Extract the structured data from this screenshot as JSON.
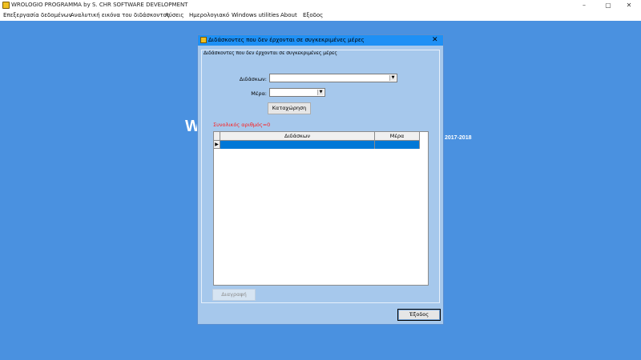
{
  "app": {
    "title": "WROLOGIO PROGRAMMA by S. CHR SOFTWARE DEVELOPMENT",
    "icon": "app-logo-icon",
    "window_controls": {
      "minimize": "–",
      "maximize": "▢",
      "close": "✕"
    }
  },
  "menu": {
    "items": [
      "Επεξεργασία δεδομένων",
      "Αναλυτική εικόνα του διδάσκοντος",
      "Λύσεις",
      "Ημερολογιακό",
      "Windows utilities",
      "About",
      "Εξοδος"
    ]
  },
  "background": {
    "big_text": "W",
    "year_text": "2017-2018",
    "color": "#4a91e0"
  },
  "dialog": {
    "title": "Διδάσκοντες που δεν έρχονται σε συγκεκριμένες μέρες",
    "close_glyph": "✕",
    "group_title": "Διδάσκοντες που δεν έρχονται σε συγκεκριμένες μέρες",
    "teacher_label": "Διδάσκων:",
    "teacher_value": "",
    "day_label": "Μέρα:",
    "day_value": "",
    "dropdown_glyph": "▼",
    "submit_label": "Καταχώρηση",
    "count_text": "Συνολικός αριθμός=0",
    "count_color": "#ff1a1a",
    "table": {
      "columns": [
        "Διδάσκων",
        "Μέρα"
      ],
      "rows": [
        [
          "",
          ""
        ]
      ],
      "row_indicator": "▶",
      "selection_color": "#0078d7"
    },
    "delete_label": "Διαγραφή",
    "exit_label": "Έξοδος",
    "title_bar_color": "#1e90f5",
    "body_color": "#a6c8ec"
  }
}
